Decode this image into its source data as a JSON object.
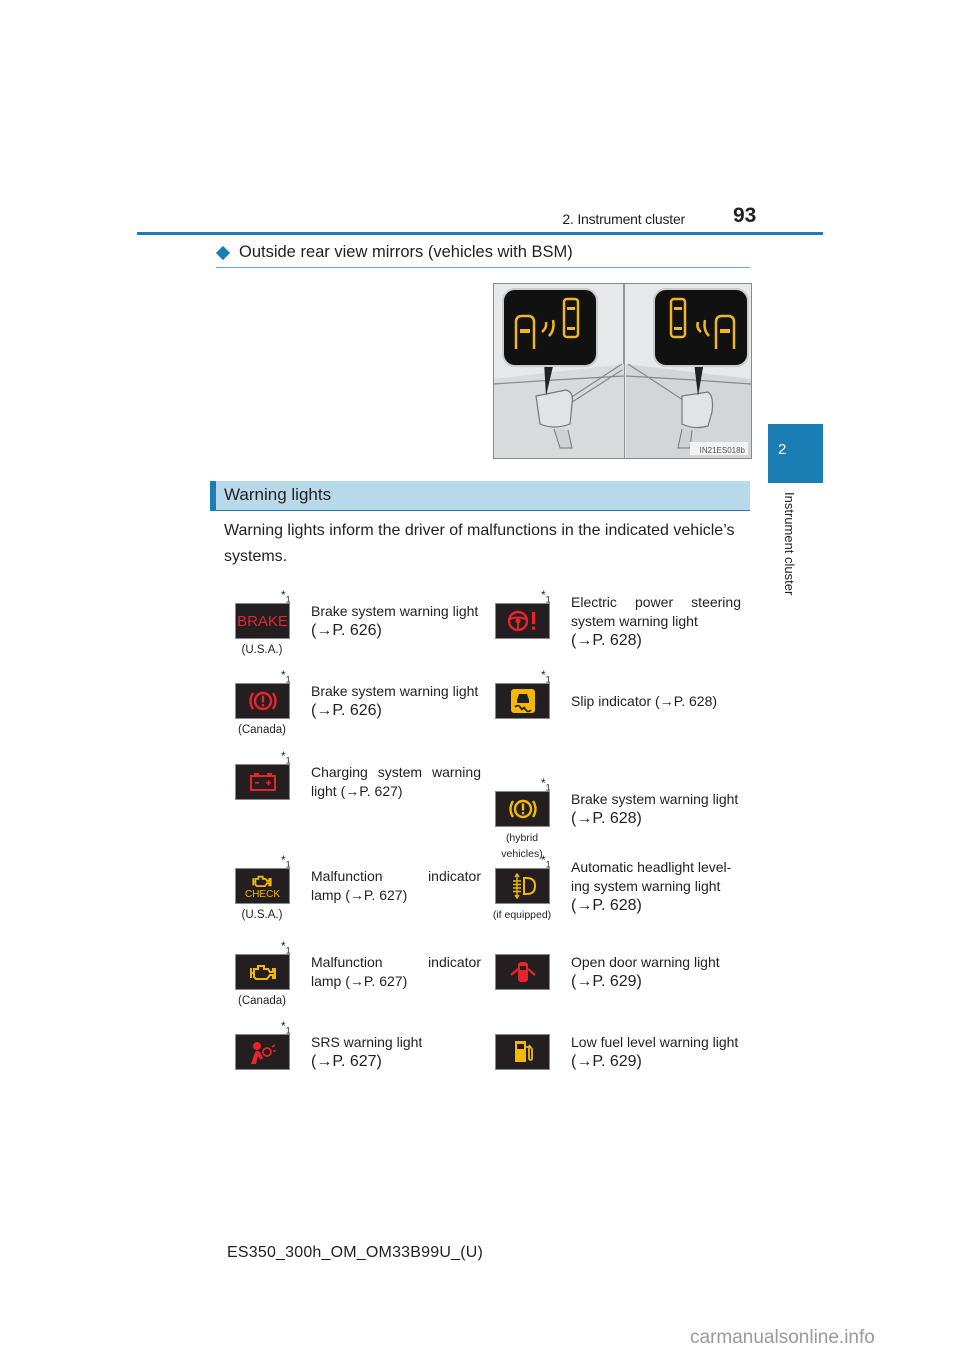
{
  "header": {
    "section": "2. Instrument cluster",
    "page_number": "93"
  },
  "side_tab": {
    "chapter_number": "2",
    "chapter_label": "Instrument cluster"
  },
  "subsection": {
    "title": "Outside rear view mirrors (vehicles with BSM)",
    "image_code": "IN21ES018b"
  },
  "warning_lights": {
    "title": "Warning lights",
    "intro": "Warning lights inform the driver of malfunctions in the indicated vehicle’s systems.",
    "left": [
      {
        "icon": "brake-text-icon",
        "icon_text": "BRAKE",
        "color": "#e8232a",
        "note": "*1",
        "caption": "(U.S.A.)",
        "lines": [
          "Brake system warning light",
          "(→P. 626)"
        ]
      },
      {
        "icon": "brake-circle-icon",
        "color": "#e8232a",
        "note": "*1",
        "caption": "(Canada)",
        "lines": [
          "Brake system warning light",
          "(→P. 626)"
        ]
      },
      {
        "icon": "battery-icon",
        "color": "#e8232a",
        "note": "*1",
        "caption": "",
        "lines": [
          "Charging system warning",
          "light (→P. 627)"
        ]
      },
      {
        "icon": "check-engine-icon",
        "icon_text": "CHECK",
        "color": "#f5b800",
        "note": "*1",
        "caption": "(U.S.A.)",
        "lines": [
          "Malfunction indicator",
          "lamp (→P. 627)"
        ]
      },
      {
        "icon": "engine-icon",
        "color": "#f5b800",
        "note": "*1",
        "caption": "(Canada)",
        "lines": [
          "Malfunction indicator",
          "lamp (→P. 627)"
        ]
      },
      {
        "icon": "airbag-icon",
        "color": "#e8232a",
        "note": "*1",
        "caption": "",
        "lines": [
          "SRS warning light",
          "(→P. 627)"
        ]
      }
    ],
    "right": [
      {
        "icon": "steering-wheel-icon",
        "color": "#e8232a",
        "note": "*1",
        "caption": "",
        "lines": [
          "Electric power steering",
          "system warning light",
          "(→P. 628)"
        ]
      },
      {
        "icon": "slip-indicator-icon",
        "color": "#f5b800",
        "note": "*1",
        "caption": "",
        "lines": [
          "Slip indicator (→P. 628)"
        ]
      },
      {
        "icon": "brake-circle-icon",
        "color": "#f5b800",
        "note": "*1",
        "caption": "(hybrid vehicles)",
        "lines": [
          "Brake system warning light",
          "(→P. 628)"
        ]
      },
      {
        "icon": "headlight-leveling-icon",
        "color": "#f5b800",
        "note": "*1",
        "caption": "(if equipped)",
        "lines": [
          "Automatic headlight level-",
          "ing system warning light",
          "(→P. 628)"
        ]
      },
      {
        "icon": "open-door-icon",
        "color": "#e8232a",
        "note": "",
        "caption": "",
        "lines": [
          "Open door warning light",
          "(→P. 629)"
        ]
      },
      {
        "icon": "fuel-pump-icon",
        "color": "#f5b800",
        "note": "",
        "caption": "",
        "lines": [
          "Low fuel level warning light",
          "(→P. 629)"
        ]
      }
    ]
  },
  "footer": {
    "doc_code": "ES350_300h_OM_OM33B99U_(U)"
  },
  "watermark": "carmanualsonline.info"
}
